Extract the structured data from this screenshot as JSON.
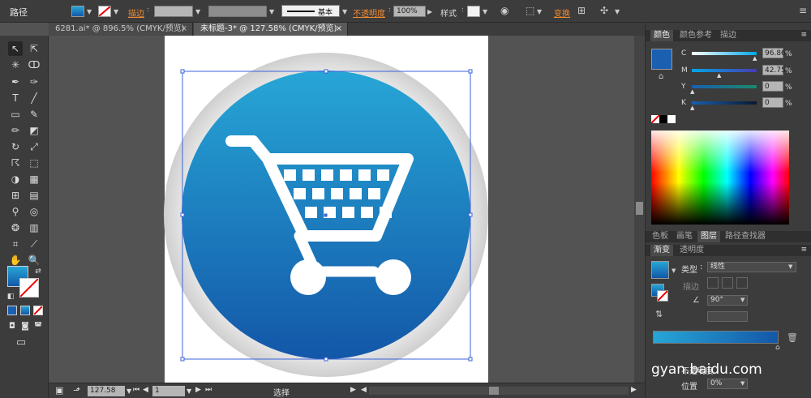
{
  "control_bar": {
    "selection_label": "路径",
    "stroke_label": "描边",
    "stroke_style_label": "基本",
    "opacity_label": "不透明度",
    "opacity_value": "100%",
    "style_label": "样式",
    "transform_label": "变换"
  },
  "doc_tabs": [
    {
      "label": "6281.ai* @ 896.5% (CMYK/预览)",
      "close": "×"
    },
    {
      "label": "未标题-3* @ 127.58% (CMYK/预览)",
      "close": "×"
    }
  ],
  "status_bar": {
    "zoom": "127.58",
    "page": "1",
    "mode": "选择"
  },
  "color_panel": {
    "tabs": [
      "颜色",
      "颜色参考",
      "描边"
    ],
    "channels": [
      {
        "name": "C",
        "value": "96.86",
        "unit": "%"
      },
      {
        "name": "M",
        "value": "42.75",
        "unit": "%"
      },
      {
        "name": "Y",
        "value": "0",
        "unit": "%"
      },
      {
        "name": "K",
        "value": "0",
        "unit": "%"
      }
    ]
  },
  "layers_tabs": [
    "色板",
    "画笔",
    "图层",
    "路径查找器"
  ],
  "gradient_panel": {
    "tabs": [
      "渐变",
      "透明度"
    ],
    "type_label": "类型",
    "type_value": "线性",
    "stroke_label": "描边",
    "angle_value": "90°",
    "opacity_label": "不透明度",
    "location_label": "位置",
    "location_value": "0%"
  },
  "watermark": {
    "text": "gyan.baidu.com"
  },
  "colors": {
    "fill_gradient_top": "#27a6d6",
    "fill_gradient_bottom": "#1357a8",
    "outer_ring": "#d9d9d9",
    "selection": "#3b63d9",
    "accent_link": "#f08a30"
  }
}
